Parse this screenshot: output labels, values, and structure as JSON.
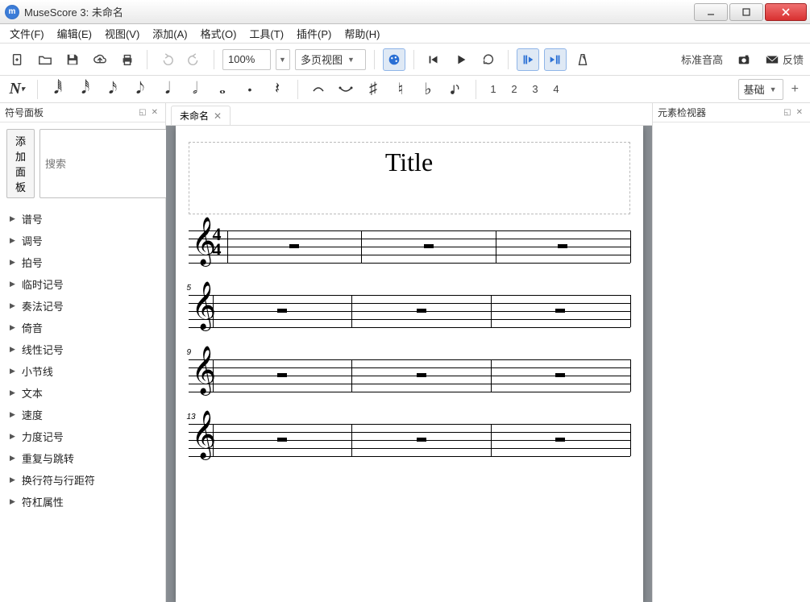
{
  "window": {
    "title": "MuseScore 3: 未命名"
  },
  "menu": [
    "文件(F)",
    "编辑(E)",
    "视图(V)",
    "添加(A)",
    "格式(O)",
    "工具(T)",
    "插件(P)",
    "帮助(H)"
  ],
  "toolbar": {
    "zoom": "100%",
    "view_mode": "多页视图",
    "pitch_label": "标准音高",
    "feedback": "反馈"
  },
  "note_toolbar": {
    "voices": [
      "1",
      "2",
      "3",
      "4"
    ],
    "selector": "基础"
  },
  "palette_panel": {
    "title": "符号面板",
    "add": "添加面板",
    "search_placeholder": "搜索",
    "items": [
      "谱号",
      "调号",
      "拍号",
      "临时记号",
      "奏法记号",
      "倚音",
      "线性记号",
      "小节线",
      "文本",
      "速度",
      "力度记号",
      "重复与跳转",
      "换行符与行距符",
      "符杠属性"
    ]
  },
  "inspector": {
    "title": "元素检视器"
  },
  "document": {
    "tab": "未命名",
    "title": "Title",
    "time_sig_top": "4",
    "time_sig_bot": "4",
    "system_numbers": [
      "",
      "5",
      "9",
      "13"
    ]
  }
}
